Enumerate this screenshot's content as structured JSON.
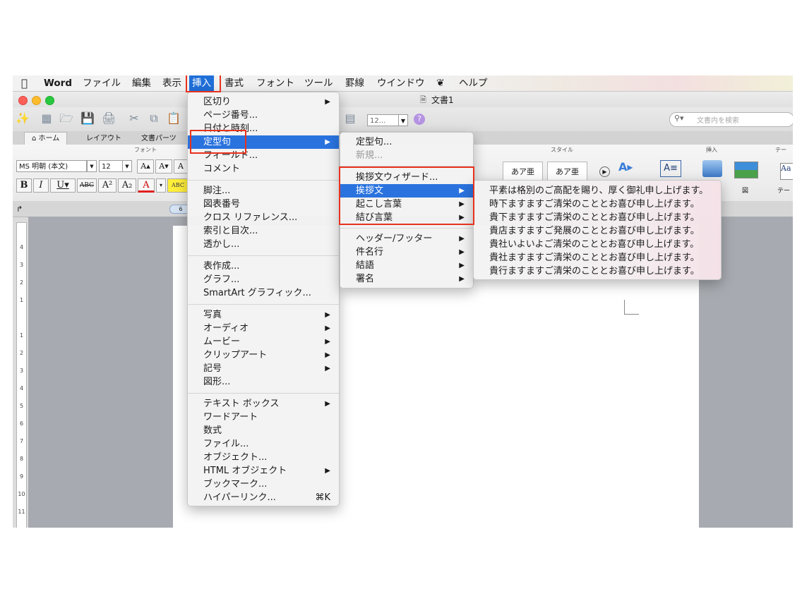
{
  "menubar": {
    "app": "Word",
    "items": [
      "ファイル",
      "編集",
      "表示",
      "挿入",
      "書式",
      "フォント",
      "ツール",
      "罫線",
      "ウインドウ",
      "ヘルプ"
    ],
    "selected": "挿入"
  },
  "window": {
    "title": "文書1"
  },
  "toolbar": {
    "zoom": "12...",
    "search_placeholder": "文書内を検索"
  },
  "ribbon": {
    "tabs": [
      "ホーム",
      "レイアウト",
      "文書パーツ"
    ],
    "group_font": "フォント",
    "group_style": "スタイル",
    "group_insert": "挿入",
    "group_theme": "テー",
    "font_name": "MS 明朝 (本文)",
    "font_size": "12",
    "style_samples": [
      "あア亜",
      "あア亜"
    ],
    "style_sample_extra": "Aa",
    "insert_label_fig": "図",
    "insert_label_theme": "テー",
    "ruler_marker": "6"
  },
  "vruler_ticks": [
    "4",
    "3",
    "2",
    "1",
    "1",
    "2",
    "3",
    "4",
    "5",
    "6",
    "7",
    "8",
    "9",
    "10",
    "11"
  ],
  "insert_menu": {
    "groups": [
      [
        {
          "label": "区切り",
          "submenu": true
        },
        {
          "label": "ページ番号..."
        },
        {
          "label": "日付と時刻..."
        },
        {
          "label": "定型句",
          "submenu": true,
          "highlighted": true
        },
        {
          "label": "フィールド..."
        },
        {
          "label": "コメント"
        }
      ],
      [
        {
          "label": "脚注..."
        },
        {
          "label": "図表番号"
        },
        {
          "label": "クロス リファレンス..."
        },
        {
          "label": "索引と目次..."
        },
        {
          "label": "透かし..."
        }
      ],
      [
        {
          "label": "表作成..."
        },
        {
          "label": "グラフ..."
        },
        {
          "label": "SmartArt グラフィック..."
        }
      ],
      [
        {
          "label": "写真",
          "submenu": true
        },
        {
          "label": "オーディオ",
          "submenu": true
        },
        {
          "label": "ムービー",
          "submenu": true
        },
        {
          "label": "クリップアート",
          "submenu": true
        },
        {
          "label": "記号",
          "submenu": true
        },
        {
          "label": "図形..."
        }
      ],
      [
        {
          "label": "テキスト ボックス",
          "submenu": true
        },
        {
          "label": "ワードアート"
        },
        {
          "label": "数式"
        },
        {
          "label": "ファイル..."
        },
        {
          "label": "オブジェクト..."
        },
        {
          "label": "HTML オブジェクト",
          "submenu": true
        },
        {
          "label": "ブックマーク..."
        },
        {
          "label": "ハイパーリンク...",
          "shortcut": "⌘K"
        }
      ]
    ]
  },
  "autotext_menu": {
    "top": [
      {
        "label": "定型句..."
      },
      {
        "label": "新規...",
        "disabled": true
      }
    ],
    "groups": [
      {
        "label": "挨拶文ウィザード..."
      },
      {
        "label": "挨拶文",
        "submenu": true,
        "highlighted": true
      },
      {
        "label": "起こし言葉",
        "submenu": true
      },
      {
        "label": "結び言葉",
        "submenu": true
      }
    ],
    "bottom": [
      {
        "label": "ヘッダー/フッター",
        "submenu": true
      },
      {
        "label": "件名行",
        "submenu": true
      },
      {
        "label": "結語",
        "submenu": true
      },
      {
        "label": "署名",
        "submenu": true
      }
    ]
  },
  "greeting_menu": {
    "items": [
      "平素は格別のご高配を賜り、厚く御礼申し上げます。",
      "時下ますますご清栄のこととお喜び申し上げます。",
      "貴下ますますご清栄のこととお喜び申し上げます。",
      "貴店ますますご発展のこととお喜び申し上げます。",
      "貴社いよいよご清栄のこととお喜び申し上げます。",
      "貴社ますますご清栄のこととお喜び申し上げます。",
      "貴行ますますご清栄のこととお喜び申し上げます。"
    ]
  },
  "colors": {
    "highlight": "#2a73de",
    "annotation": "#e8321e"
  }
}
